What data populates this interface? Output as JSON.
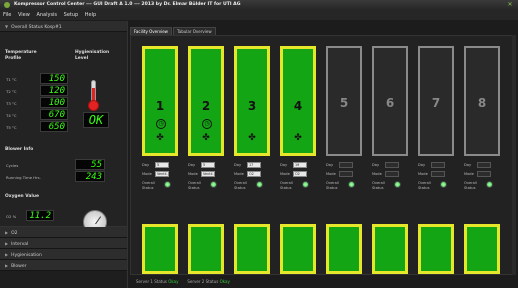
{
  "window": {
    "title": "Kompressor Control Center  ---  GUI Draft A 1.0  ---  2013 by Dr. Elmar Bülder IT for UTI AG"
  },
  "menu": [
    "File",
    "View",
    "Analysis",
    "Setup",
    "Help"
  ],
  "sidebar": {
    "overall_header": "Overall Status Kosp#1",
    "temperature_profile": "Temperature Profile",
    "hygienisation_level": "Hygienisation Level",
    "temps": [
      {
        "label": "T1 °C",
        "value": "150"
      },
      {
        "label": "T2 °C",
        "value": "120"
      },
      {
        "label": "T3 °C",
        "value": "100"
      },
      {
        "label": "T4 °C",
        "value": "670"
      },
      {
        "label": "T5 °C",
        "value": "650"
      }
    ],
    "hyg_status": "OK",
    "blower_info": "Blower Info",
    "cycles_label": "Cycles",
    "cycles_value": "55",
    "running_label": "Running Time Hrs.",
    "running_value": "243",
    "oxygen_label": "Oxygen Value",
    "o2_label": "O2 %",
    "o2_value": "11.2",
    "groups": [
      "O2",
      "Interval",
      "Hygienisation",
      "Blower"
    ]
  },
  "tabs": [
    "Facility Overview",
    "Tabular Overview"
  ],
  "units": [
    {
      "num": "1",
      "active": true,
      "clock": true,
      "day": "5",
      "mode": "Ventil.",
      "overall_status": "Overall Status"
    },
    {
      "num": "2",
      "active": true,
      "clock": true,
      "day": "5",
      "mode": "Ventil.",
      "overall_status": "Overall Status"
    },
    {
      "num": "3",
      "active": true,
      "clock": false,
      "day": "17",
      "mode": "O2",
      "overall_status": "Overall Status"
    },
    {
      "num": "4",
      "active": true,
      "clock": false,
      "day": "19",
      "mode": "O2",
      "overall_status": "Overall Status"
    },
    {
      "num": "5",
      "active": false,
      "clock": false,
      "day": "",
      "mode": "",
      "overall_status": "Overall Status"
    },
    {
      "num": "6",
      "active": false,
      "clock": false,
      "day": "",
      "mode": "",
      "overall_status": "Overall Status"
    },
    {
      "num": "7",
      "active": false,
      "clock": false,
      "day": "",
      "mode": "",
      "overall_status": "Overall Status"
    },
    {
      "num": "8",
      "active": false,
      "clock": false,
      "day": "",
      "mode": "",
      "overall_status": "Overall Status"
    }
  ],
  "labels": {
    "day": "Day",
    "mode": "Mode"
  },
  "statusbar": {
    "server1": "Server 1 Status",
    "server1_state": "Okay",
    "server2": "Server 2 Status",
    "server2_state": "Okay"
  },
  "colors": {
    "active_fill": "#14a514",
    "active_border": "#e6e62a",
    "lcd": "#39ff14"
  }
}
